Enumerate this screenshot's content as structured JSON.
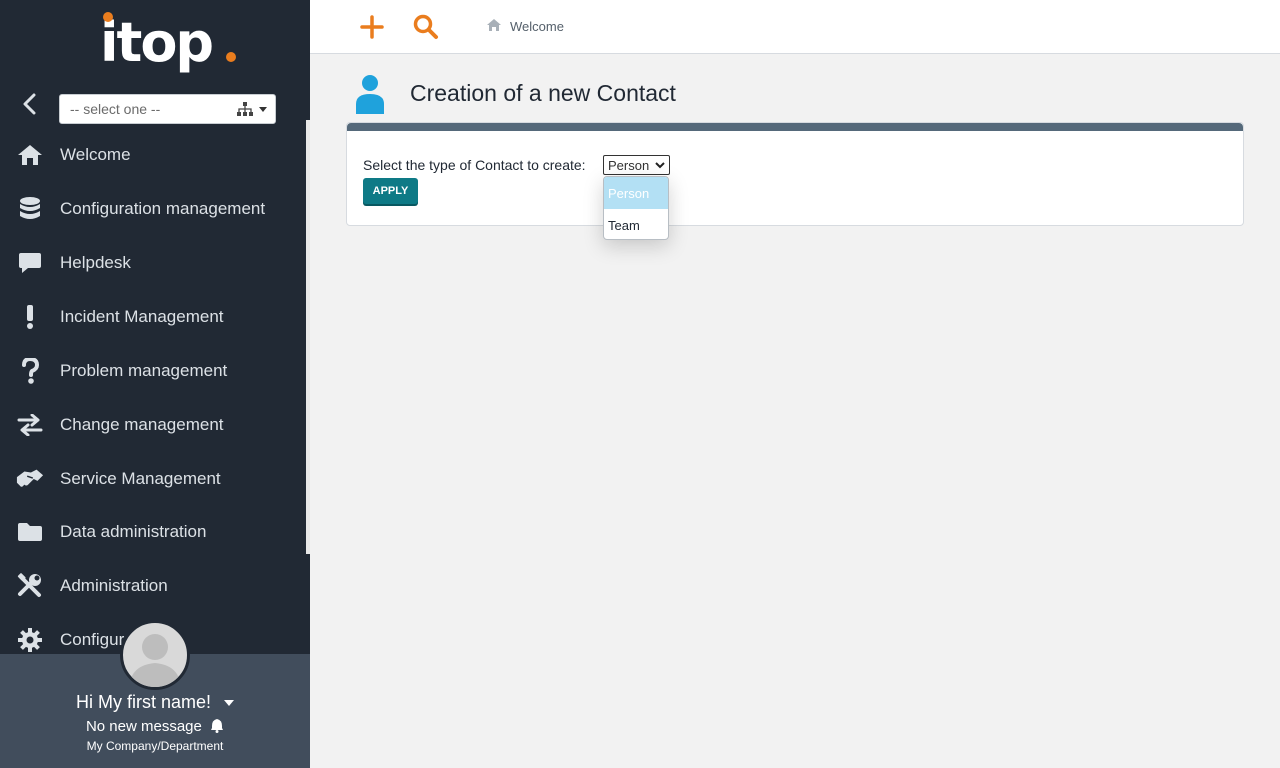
{
  "app": {
    "logo": "itop"
  },
  "colors": {
    "sidebar": "#212934",
    "accent": "#ea7d1e",
    "apply": "#0e7a86",
    "selection": "#b3e0f4"
  },
  "sidebar": {
    "collapse_icon": "chevron-left-icon",
    "org_select": {
      "value": "-- select one --",
      "icon": "sitemap-icon"
    },
    "items": [
      {
        "label": "Welcome",
        "icon": "home-icon"
      },
      {
        "label": "Configuration management",
        "icon": "database-icon"
      },
      {
        "label": "Helpdesk",
        "icon": "comment-icon"
      },
      {
        "label": "Incident Management",
        "icon": "exclamation-icon"
      },
      {
        "label": "Problem management",
        "icon": "question-icon"
      },
      {
        "label": "Change management",
        "icon": "exchange-icon"
      },
      {
        "label": "Service Management",
        "icon": "handshake-icon"
      },
      {
        "label": "Data administration",
        "icon": "folder-icon"
      },
      {
        "label": "Administration",
        "icon": "tools-icon"
      },
      {
        "label": "Configur",
        "icon": "gear-icon"
      }
    ],
    "user": {
      "greeting": "Hi My first name!",
      "messages": "No new message",
      "organization": "My Company/Department"
    }
  },
  "topbar": {
    "new_icon": "plus-icon",
    "search_icon": "search-icon",
    "breadcrumb": "Welcome"
  },
  "main": {
    "title": "Creation of a new Contact",
    "type_label": "Select the type of Contact to create:",
    "type_select": {
      "value": "Person",
      "options": [
        "Person",
        "Team"
      ]
    },
    "apply_label": "APPLY"
  }
}
